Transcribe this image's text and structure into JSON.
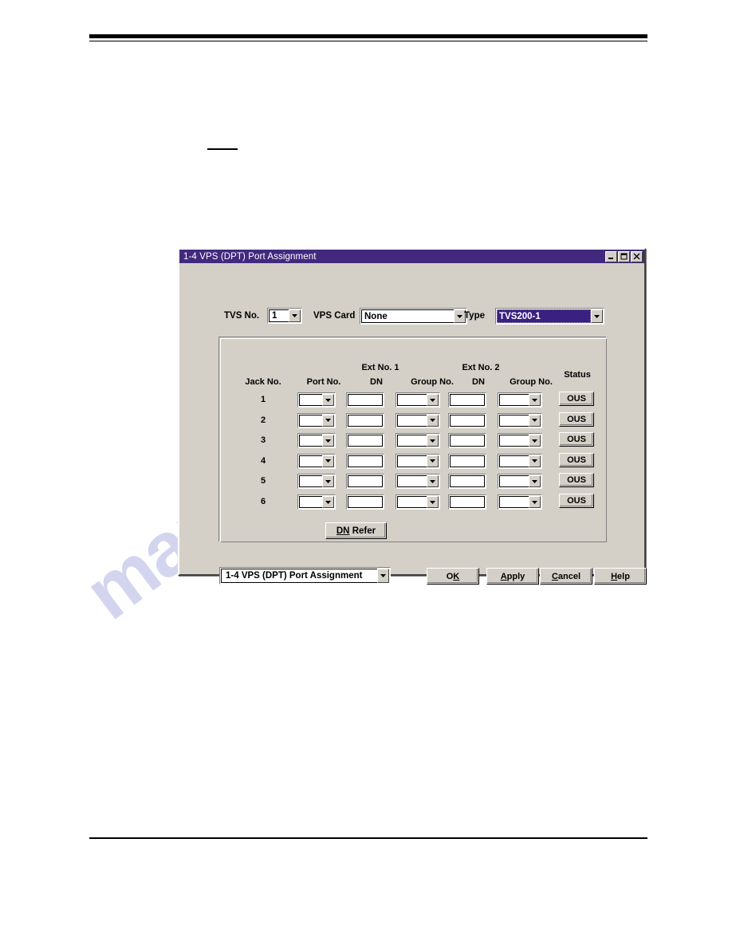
{
  "window": {
    "title": "1-4 VPS (DPT) Port Assignment",
    "controls": {
      "minimize": "minimize-icon",
      "maximize": "maximize-icon",
      "close": "close-icon"
    }
  },
  "top_controls": {
    "tvs_no_label": "TVS No.",
    "tvs_no_value": "1",
    "vps_card_label": "VPS Card",
    "vps_card_value": "None",
    "type_label": "Type",
    "type_value": "TVS200-1",
    "type_selected_bg": "#3a2080"
  },
  "table": {
    "headers": {
      "jack_no": "Jack No.",
      "port_no": "Port No.",
      "ext_no_1": "Ext No. 1",
      "ext_no_2": "Ext No. 2",
      "dn_1": "DN",
      "group_no_1": "Group No.",
      "dn_2": "DN",
      "group_no_2": "Group No.",
      "status": "Status"
    },
    "rows": [
      {
        "jack_no": "1",
        "port_no": "",
        "dn_1": "",
        "group_no_1": "",
        "dn_2": "",
        "group_no_2": "",
        "status": "OUS"
      },
      {
        "jack_no": "2",
        "port_no": "",
        "dn_1": "",
        "group_no_1": "",
        "dn_2": "",
        "group_no_2": "",
        "status": "OUS"
      },
      {
        "jack_no": "3",
        "port_no": "",
        "dn_1": "",
        "group_no_1": "",
        "dn_2": "",
        "group_no_2": "",
        "status": "OUS"
      },
      {
        "jack_no": "4",
        "port_no": "",
        "dn_1": "",
        "group_no_1": "",
        "dn_2": "",
        "group_no_2": "",
        "status": "OUS"
      },
      {
        "jack_no": "5",
        "port_no": "",
        "dn_1": "",
        "group_no_1": "",
        "dn_2": "",
        "group_no_2": "",
        "status": "OUS"
      },
      {
        "jack_no": "6",
        "port_no": "",
        "dn_1": "",
        "group_no_1": "",
        "dn_2": "",
        "group_no_2": "",
        "status": "OUS"
      }
    ]
  },
  "buttons": {
    "dn_refer": {
      "mnemonic": "DN",
      "rest": " Refer"
    },
    "ok": {
      "pre": "O",
      "mnemonic": "K",
      "rest": ""
    },
    "apply": {
      "pre": "",
      "mnemonic": "A",
      "rest": "pply"
    },
    "cancel": {
      "pre": "",
      "mnemonic": "C",
      "rest": "ancel"
    },
    "help": {
      "pre": "",
      "mnemonic": "H",
      "rest": "elp"
    }
  },
  "bottom_combo": {
    "value": "1-4 VPS (DPT) Port Assignment"
  },
  "watermark": {
    "text": "manualslib.com",
    "color": "#b9bce6"
  },
  "theme": {
    "titlebar": "#42297e",
    "dialog_face": "#d4d0c8",
    "page_background": "#ffffff"
  }
}
